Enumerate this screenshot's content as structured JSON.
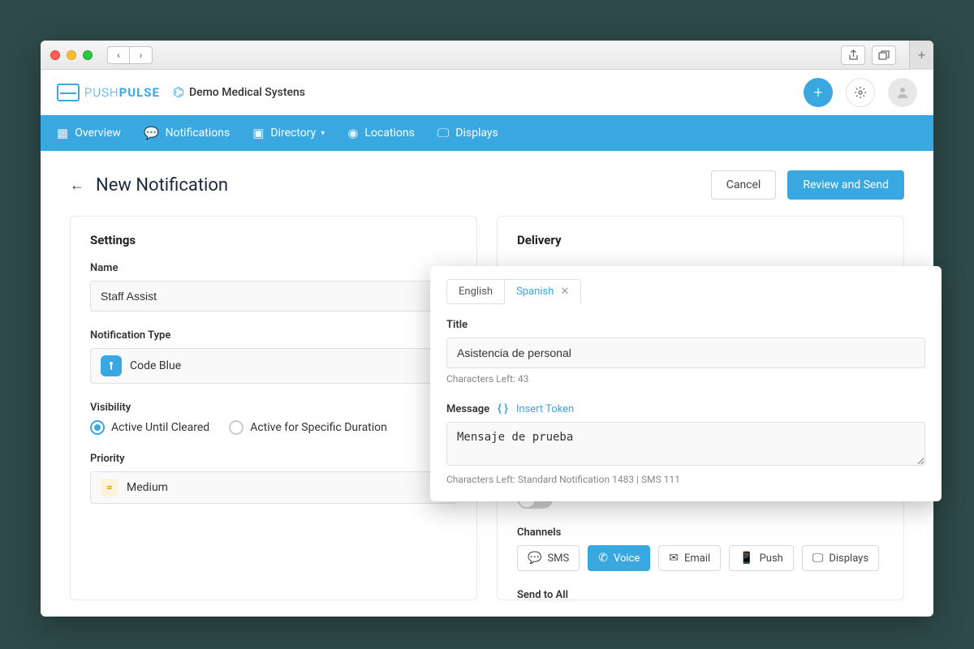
{
  "app": {
    "logo_thin": "PUSH",
    "logo_bold": "PULSE",
    "org_name": "Demo Medical Systens"
  },
  "nav": {
    "overview": "Overview",
    "notifications": "Notifications",
    "directory": "Directory",
    "locations": "Locations",
    "displays": "Displays"
  },
  "page": {
    "title": "New Notification",
    "cancel": "Cancel",
    "review_send": "Review and Send"
  },
  "settings": {
    "panel_title": "Settings",
    "name_label": "Name",
    "name_value": "Staff Assist",
    "type_label": "Notification Type",
    "type_value": "Code Blue",
    "visibility_label": "Visibility",
    "visibility_active_cleared": "Active Until Cleared",
    "visibility_active_duration": "Active for Specific Duration",
    "priority_label": "Priority",
    "priority_value": "Medium"
  },
  "delivery": {
    "panel_title": "Delivery",
    "channels_label": "Channels",
    "send_all_label": "Send to All",
    "channels": {
      "sms": "SMS",
      "voice": "Voice",
      "email": "Email",
      "push": "Push",
      "displays": "Displays"
    }
  },
  "lang_card": {
    "tab_english": "English",
    "tab_spanish": "Spanish",
    "title_label": "Title",
    "title_value": "Asistencia de personal",
    "title_chars_left": "Characters Left: 43",
    "message_label": "Message",
    "insert_token": "Insert Token",
    "message_value": "Mensaje de prueba",
    "message_chars_left": "Characters Left: Standard Notification 1483 | SMS 111"
  }
}
